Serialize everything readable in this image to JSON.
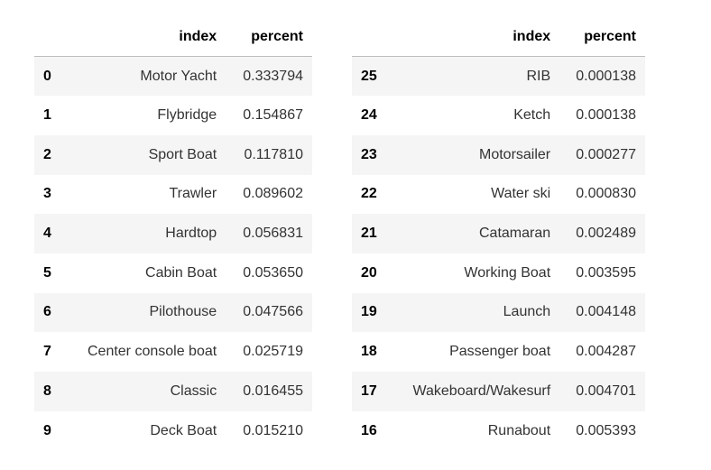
{
  "left_table": {
    "headers": {
      "index_col": "",
      "name_col": "index",
      "value_col": "percent"
    },
    "rows": [
      {
        "idx": "0",
        "name": "Motor Yacht",
        "percent": "0.333794"
      },
      {
        "idx": "1",
        "name": "Flybridge",
        "percent": "0.154867"
      },
      {
        "idx": "2",
        "name": "Sport Boat",
        "percent": "0.117810"
      },
      {
        "idx": "3",
        "name": "Trawler",
        "percent": "0.089602"
      },
      {
        "idx": "4",
        "name": "Hardtop",
        "percent": "0.056831"
      },
      {
        "idx": "5",
        "name": "Cabin Boat",
        "percent": "0.053650"
      },
      {
        "idx": "6",
        "name": "Pilothouse",
        "percent": "0.047566"
      },
      {
        "idx": "7",
        "name": "Center console boat",
        "percent": "0.025719"
      },
      {
        "idx": "8",
        "name": "Classic",
        "percent": "0.016455"
      },
      {
        "idx": "9",
        "name": "Deck Boat",
        "percent": "0.015210"
      }
    ]
  },
  "right_table": {
    "headers": {
      "index_col": "",
      "name_col": "index",
      "value_col": "percent"
    },
    "rows": [
      {
        "idx": "25",
        "name": "RIB",
        "percent": "0.000138"
      },
      {
        "idx": "24",
        "name": "Ketch",
        "percent": "0.000138"
      },
      {
        "idx": "23",
        "name": "Motorsailer",
        "percent": "0.000277"
      },
      {
        "idx": "22",
        "name": "Water ski",
        "percent": "0.000830"
      },
      {
        "idx": "21",
        "name": "Catamaran",
        "percent": "0.002489"
      },
      {
        "idx": "20",
        "name": "Working Boat",
        "percent": "0.003595"
      },
      {
        "idx": "19",
        "name": "Launch",
        "percent": "0.004148"
      },
      {
        "idx": "18",
        "name": "Passenger boat",
        "percent": "0.004287"
      },
      {
        "idx": "17",
        "name": "Wakeboard/Wakesurf",
        "percent": "0.004701"
      },
      {
        "idx": "16",
        "name": "Runabout",
        "percent": "0.005393"
      }
    ]
  }
}
